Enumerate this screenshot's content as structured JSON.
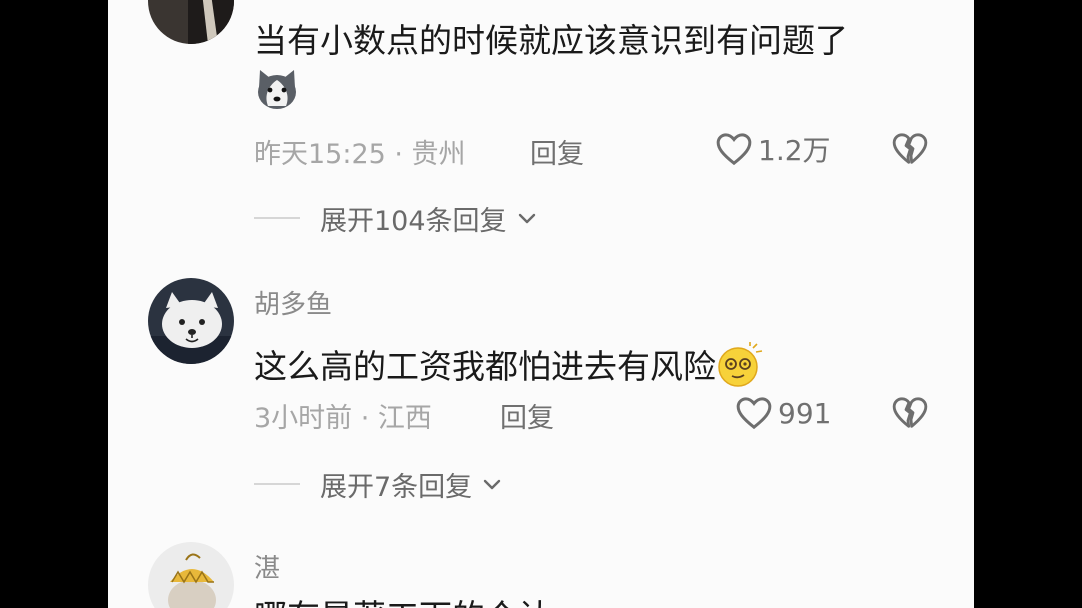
{
  "comments": [
    {
      "text": "当有小数点的时候就应该意识到有问题了",
      "time_location": "昨天15:25 · 贵州",
      "reply_label": "回复",
      "likes": "1.2万",
      "expand_label": "展开104条回复"
    },
    {
      "username": "胡多鱼",
      "text": "这么高的工资我都怕进去有风险",
      "time_location": "3小时前 · 江西",
      "reply_label": "回复",
      "likes": "991",
      "expand_label": "展开7条回复"
    },
    {
      "username": "湛",
      "text": "哪有是著工下的个认"
    }
  ],
  "colors": {
    "background": "#fbfbfb",
    "frame": "#000000"
  }
}
